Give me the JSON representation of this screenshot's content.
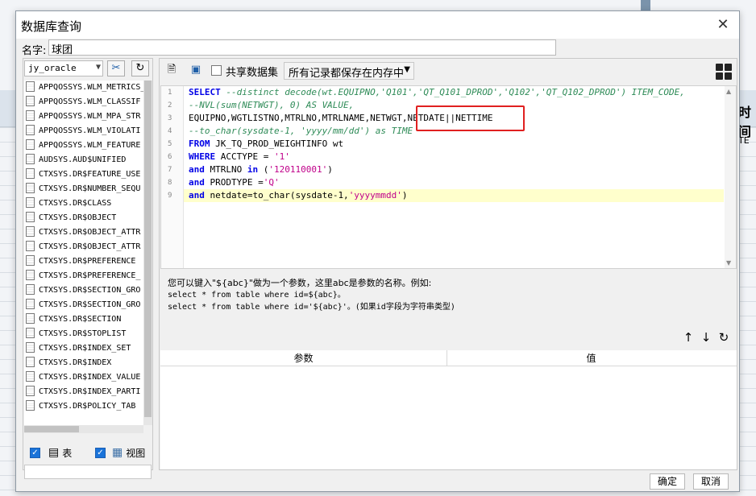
{
  "background": {
    "right_heading": "时间",
    "right_text": "TE"
  },
  "dialog": {
    "title": "数据库查询",
    "close_glyph": "✕"
  },
  "name_field": {
    "label": "名字:",
    "value": "球团"
  },
  "left": {
    "db_select": "jy_oracle",
    "tables": [
      "APPQOSSYS.WLM_METRICS_",
      "APPQOSSYS.WLM_CLASSIF",
      "APPQOSSYS.WLM_MPA_STR",
      "APPQOSSYS.WLM_VIOLATI",
      "APPQOSSYS.WLM_FEATURE",
      "AUDSYS.AUD$UNIFIED",
      "CTXSYS.DR$FEATURE_USE",
      "CTXSYS.DR$NUMBER_SEQU",
      "CTXSYS.DR$CLASS",
      "CTXSYS.DR$OBJECT",
      "CTXSYS.DR$OBJECT_ATTR",
      "CTXSYS.DR$OBJECT_ATTR",
      "CTXSYS.DR$PREFERENCE",
      "CTXSYS.DR$PREFERENCE_",
      "CTXSYS.DR$SECTION_GRO",
      "CTXSYS.DR$SECTION_GRO",
      "CTXSYS.DR$SECTION",
      "CTXSYS.DR$STOPLIST",
      "CTXSYS.DR$INDEX_SET",
      "CTXSYS.DR$INDEX",
      "CTXSYS.DR$INDEX_VALUE",
      "CTXSYS.DR$INDEX_PARTI",
      "CTXSYS.DR$POLICY_TAB"
    ],
    "filter_table_label": "表",
    "filter_view_label": "视图"
  },
  "right": {
    "share_label": "共享数据集",
    "mode_select": "所有记录都保存在内存中",
    "line_numbers": [
      "1",
      "2",
      "3",
      "4",
      "5",
      "6",
      "7",
      "8",
      "9"
    ],
    "code": {
      "l1_kw": "SELECT",
      "l1_cm": " --distinct decode(wt.EQUIPNO,'Q101','QT_Q101_DPROD','Q102','QT_Q102_DPROD') ITEM_CODE,",
      "l2_cm": "--NVL(sum(NETWGT), 0) AS VALUE,",
      "l3": "EQUIPNO,WGTLISTNO,MTRLNO,MTRLNAME,NETWGT,NETDATE||NETTIME",
      "l4_cm": "--to_char(sysdate-1, 'yyyy/mm/dd') as TIME",
      "l5_kw": "FROM",
      "l5_rest": " JK_TQ_PROD_WEIGHTINFO wt",
      "l6_kw": "WHERE",
      "l6_mid": " ACCTYPE = ",
      "l6_str": "'1'",
      "l7_kw1": "and",
      "l7_mid": " MTRLNO ",
      "l7_kw2": "in",
      "l7_p1": " (",
      "l7_str": "'120110001'",
      "l7_p2": ")",
      "l8_kw": "and",
      "l8_mid": " PRODTYPE =",
      "l8_str": "'Q'",
      "l9_kw": "and",
      "l9_mid": " netdate=to_char(sysdate-1,",
      "l9_str": "'yyyymmdd'",
      "l9_end": ")"
    },
    "help_line1": "您可以键入\"${abc}\"做为一个参数，这里abc是参数的名称。例如:",
    "help_line2": "select * from table where id=${abc}。",
    "help_line3": "select * from table where id='${abc}'。(如果id字段为字符串类型)",
    "param_headers": [
      "参数",
      "值"
    ]
  },
  "footer": {
    "ok_label": "确定",
    "cancel_label": "取消"
  },
  "colors": {
    "keyword": "#0000e6",
    "comment": "#2e8b57",
    "string": "#c0008a",
    "highlight_box": "#e02020",
    "active_line": "#ffffcc"
  }
}
